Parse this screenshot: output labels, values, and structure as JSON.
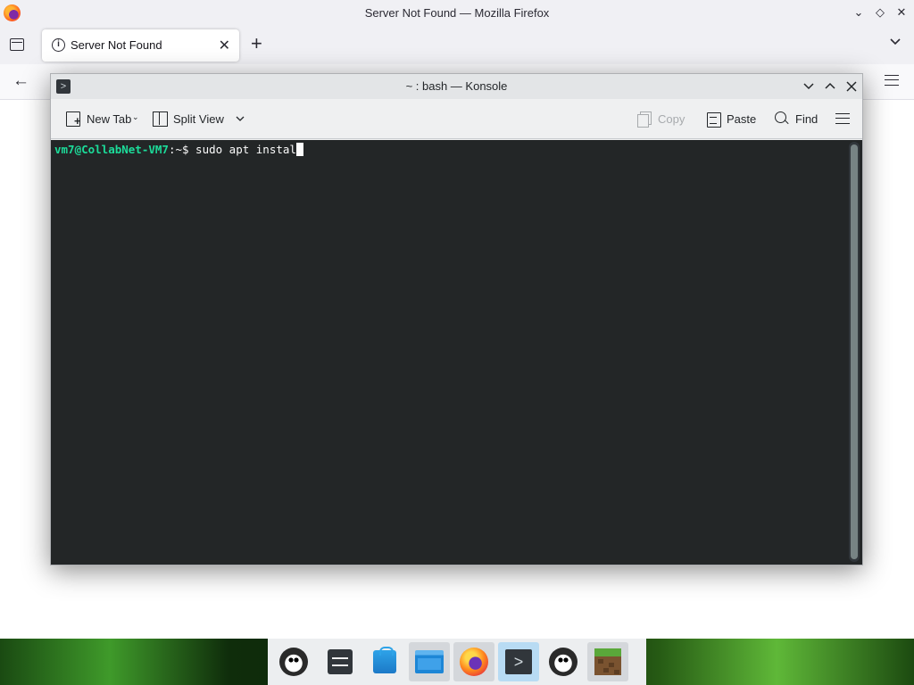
{
  "firefox": {
    "window_title": "Server Not Found — Mozilla Firefox",
    "tab_label": "Server Not Found",
    "new_tab_symbol": "+",
    "back_symbol": "←",
    "close_tab_symbol": "✕"
  },
  "konsole": {
    "window_title": "~ : bash — Konsole",
    "toolbar": {
      "new_tab": "New Tab",
      "split_view": "Split View",
      "copy": "Copy",
      "paste": "Paste",
      "find": "Find"
    },
    "terminal": {
      "user_host": "vm7@CollabNet-VM7",
      "path": ":~$",
      "command": " sudo apt instal"
    }
  },
  "taskbar": {
    "items": [
      {
        "name": "tux-icon",
        "state": "normal"
      },
      {
        "name": "settings-icon",
        "state": "normal"
      },
      {
        "name": "software-store-icon",
        "state": "normal"
      },
      {
        "name": "file-manager-icon",
        "state": "active"
      },
      {
        "name": "firefox-icon",
        "state": "active"
      },
      {
        "name": "konsole-icon",
        "state": "running"
      },
      {
        "name": "tux-icon",
        "state": "normal"
      },
      {
        "name": "minecraft-icon",
        "state": "active"
      }
    ]
  },
  "colors": {
    "terminal_bg": "#232627",
    "prompt_user_host": "#1cdc9a",
    "terminal_text": "#fcfcfc",
    "running_highlight": "#b8dbf3"
  }
}
